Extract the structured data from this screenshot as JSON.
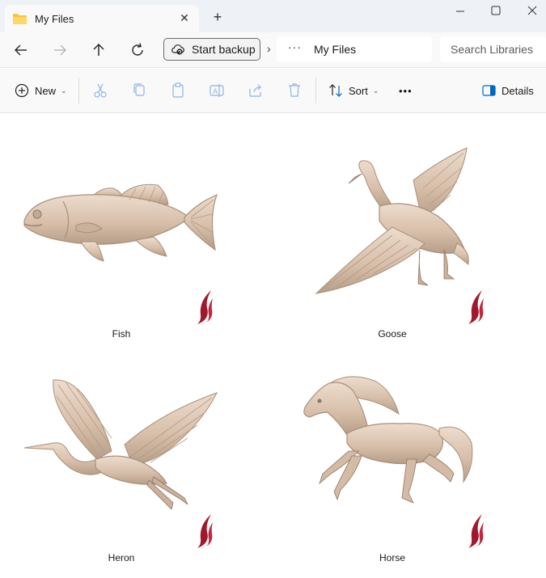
{
  "tab": {
    "title": "My Files",
    "close": "✕",
    "new_tab": "+"
  },
  "address": {
    "backup_label": "Start backup",
    "separator": "›",
    "more": "···",
    "current": "My Files",
    "search_placeholder": "Search Libraries"
  },
  "commands": {
    "new_label": "New",
    "sort_label": "Sort",
    "more": "•••",
    "details_label": "Details"
  },
  "files": [
    {
      "name": "Fish"
    },
    {
      "name": "Goose"
    },
    {
      "name": "Heron"
    },
    {
      "name": "Horse"
    }
  ],
  "colors": {
    "carving": "#d9c3b0",
    "carving_shadow": "#a98f7a",
    "logo": "#a0182b",
    "accent": "#0067c0"
  }
}
